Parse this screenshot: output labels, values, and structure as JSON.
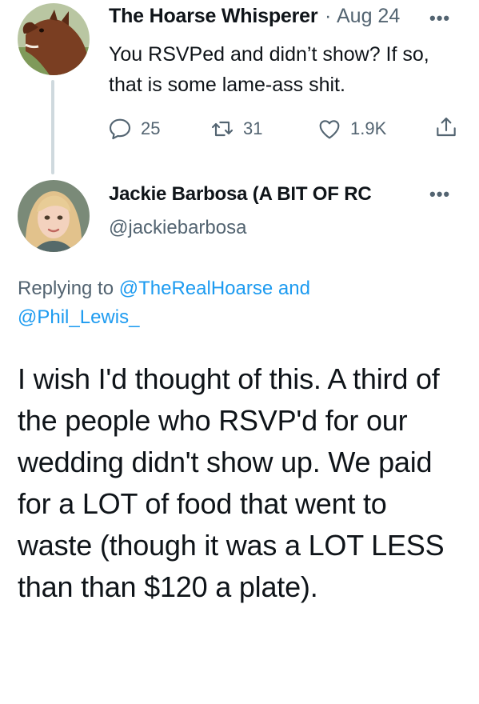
{
  "tweet1": {
    "author_name": "The Hoarse Whisperer",
    "separator": "·",
    "date": "Aug 24",
    "more_label": "•••",
    "text": "You RSVPed and didn’t show? If so, that is some lame-ass shit.",
    "replies": "25",
    "retweets": "31",
    "likes": "1.9K"
  },
  "tweet2": {
    "author_name": "Jackie Barbosa (A BIT OF RC",
    "handle": "@jackiebarbosa",
    "more_label": "•••",
    "replying_prefix": "Replying to",
    "mention1": "@TheRealHoarse",
    "conjunction": "and",
    "mention2": "@Phil_Lewis_",
    "text": "I wish I'd thought of this. A third of the people who RSVP'd for our wedding didn't show up. We paid for a LOT of food that went to waste (though it was a LOT LESS than than $120 a plate)."
  },
  "colors": {
    "text": "#0f1419",
    "secondary": "#536471",
    "link": "#1d9bf0",
    "thread_line": "#cfd9de"
  }
}
